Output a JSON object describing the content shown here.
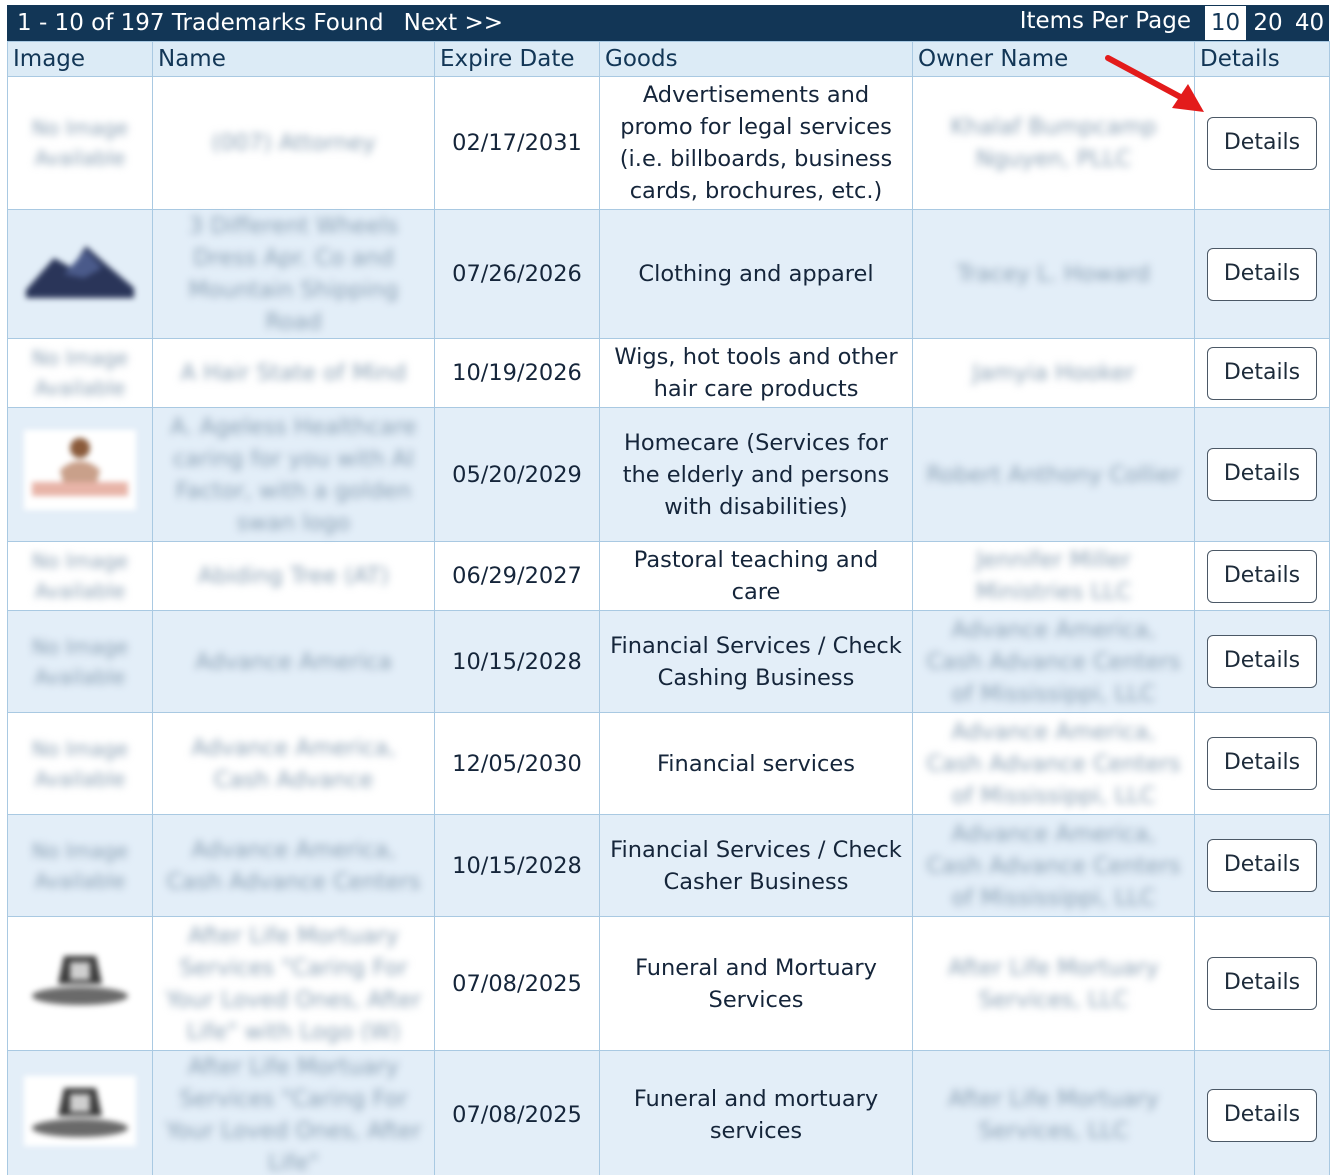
{
  "pager": {
    "summary": "1 - 10 of 197 Trademarks Found",
    "next_label": "Next >>",
    "items_per_page_label": "Items Per Page",
    "page_sizes": [
      "10",
      "20",
      "40"
    ],
    "selected_page_size": "10"
  },
  "columns": [
    "Image",
    "Name",
    "Expire Date",
    "Goods",
    "Owner Name",
    "Details"
  ],
  "rows": [
    {
      "image_text": "No Image Available",
      "name": "(007) Attorney",
      "expire_date": "02/17/2031",
      "goods": "Advertisements and promo for legal services (i.e. billboards, business cards, brochures, etc.)",
      "owner": "Khalaf Bumpcamp Nguyen, PLLC",
      "details_label": "Details"
    },
    {
      "image_text": "",
      "name": "3 Different Wheels Dress Apr. Co and Mountain Shipping Road",
      "expire_date": "07/26/2026",
      "goods": "Clothing and apparel",
      "owner": "Tracey L. Howard",
      "details_label": "Details"
    },
    {
      "image_text": "No Image Available",
      "name": "A Hair State of Mind",
      "expire_date": "10/19/2026",
      "goods": "Wigs, hot tools and other hair care products",
      "owner": "Jamyia Hooker",
      "details_label": "Details"
    },
    {
      "image_text": "",
      "name": "A. Ageless Healthcare caring for you with AI Factor, with a golden swan logo",
      "expire_date": "05/20/2029",
      "goods": "Homecare (Services for the elderly and persons with disabilities)",
      "owner": "Robert Anthony Collier",
      "details_label": "Details"
    },
    {
      "image_text": "No Image Available",
      "name": "Abiding Tree (AT)",
      "expire_date": "06/29/2027",
      "goods": "Pastoral teaching and care",
      "owner": "Jennifer Miller Ministries LLC",
      "details_label": "Details"
    },
    {
      "image_text": "No Image Available",
      "name": "Advance America",
      "expire_date": "10/15/2028",
      "goods": "Financial Services / Check Cashing Business",
      "owner": "Advance America, Cash Advance Centers of Mississippi, LLC",
      "details_label": "Details"
    },
    {
      "image_text": "No Image Available",
      "name": "Advance America, Cash Advance",
      "expire_date": "12/05/2030",
      "goods": "Financial services",
      "owner": "Advance America, Cash Advance Centers of Mississippi, LLC",
      "details_label": "Details"
    },
    {
      "image_text": "No Image Available",
      "name": "Advance America, Cash Advance Centers",
      "expire_date": "10/15/2028",
      "goods": "Financial Services / Check Casher Business",
      "owner": "Advance America, Cash Advance Centers of Mississippi, LLC",
      "details_label": "Details"
    },
    {
      "image_text": "",
      "name": "After Life Mortuary Services \"Caring For Your Loved Ones, After Life\" with Logo (W)",
      "expire_date": "07/08/2025",
      "goods": "Funeral and Mortuary Services",
      "owner": "After Life Mortuary Services, LLC",
      "details_label": "Details"
    },
    {
      "image_text": "",
      "name": "After Life Mortuary Services \"Caring For Your Loved Ones, After Life\"",
      "expire_date": "07/08/2025",
      "goods": "Funeral and mortuary services",
      "owner": "After Life Mortuary Services, LLC",
      "details_label": "Details"
    }
  ],
  "colors": {
    "header_bar": "#123656",
    "column_header_bg": "#dcebf6",
    "row_alt_bg": "#e3eef8",
    "border": "#a9c9e2",
    "arrow": "#e31b1b"
  },
  "annotation_icon": "red-arrow-icon"
}
